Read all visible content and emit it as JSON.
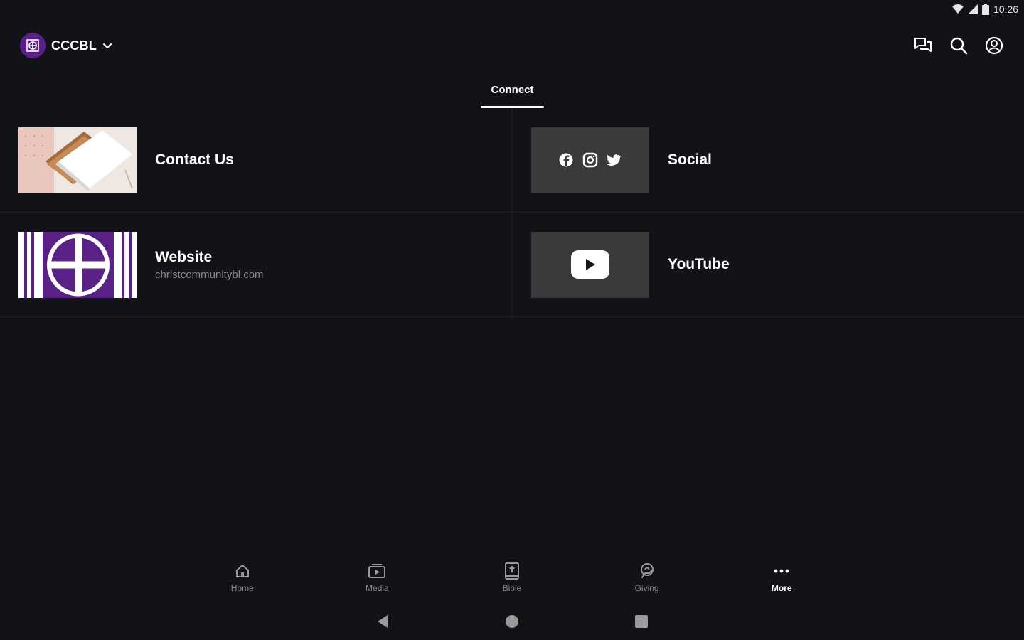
{
  "status_bar": {
    "time": "10:26"
  },
  "app_bar": {
    "org_name": "CCCBL",
    "accent_color": "#5a1f8c"
  },
  "tabs": [
    {
      "label": "Connect",
      "active": true
    }
  ],
  "items": [
    {
      "title": "Contact Us",
      "subtitle": "",
      "icon": "notebook-photo"
    },
    {
      "title": "Social",
      "subtitle": "",
      "icon": "social-icons"
    },
    {
      "title": "Website",
      "subtitle": "christcommunitybl.com",
      "icon": "church-logo"
    },
    {
      "title": "YouTube",
      "subtitle": "",
      "icon": "youtube-logo"
    }
  ],
  "bottom_nav": [
    {
      "label": "Home",
      "icon": "home-icon",
      "active": false
    },
    {
      "label": "Media",
      "icon": "media-icon",
      "active": false
    },
    {
      "label": "Bible",
      "icon": "bible-icon",
      "active": false
    },
    {
      "label": "Giving",
      "icon": "giving-icon",
      "active": false
    },
    {
      "label": "More",
      "icon": "more-icon",
      "active": true
    }
  ]
}
